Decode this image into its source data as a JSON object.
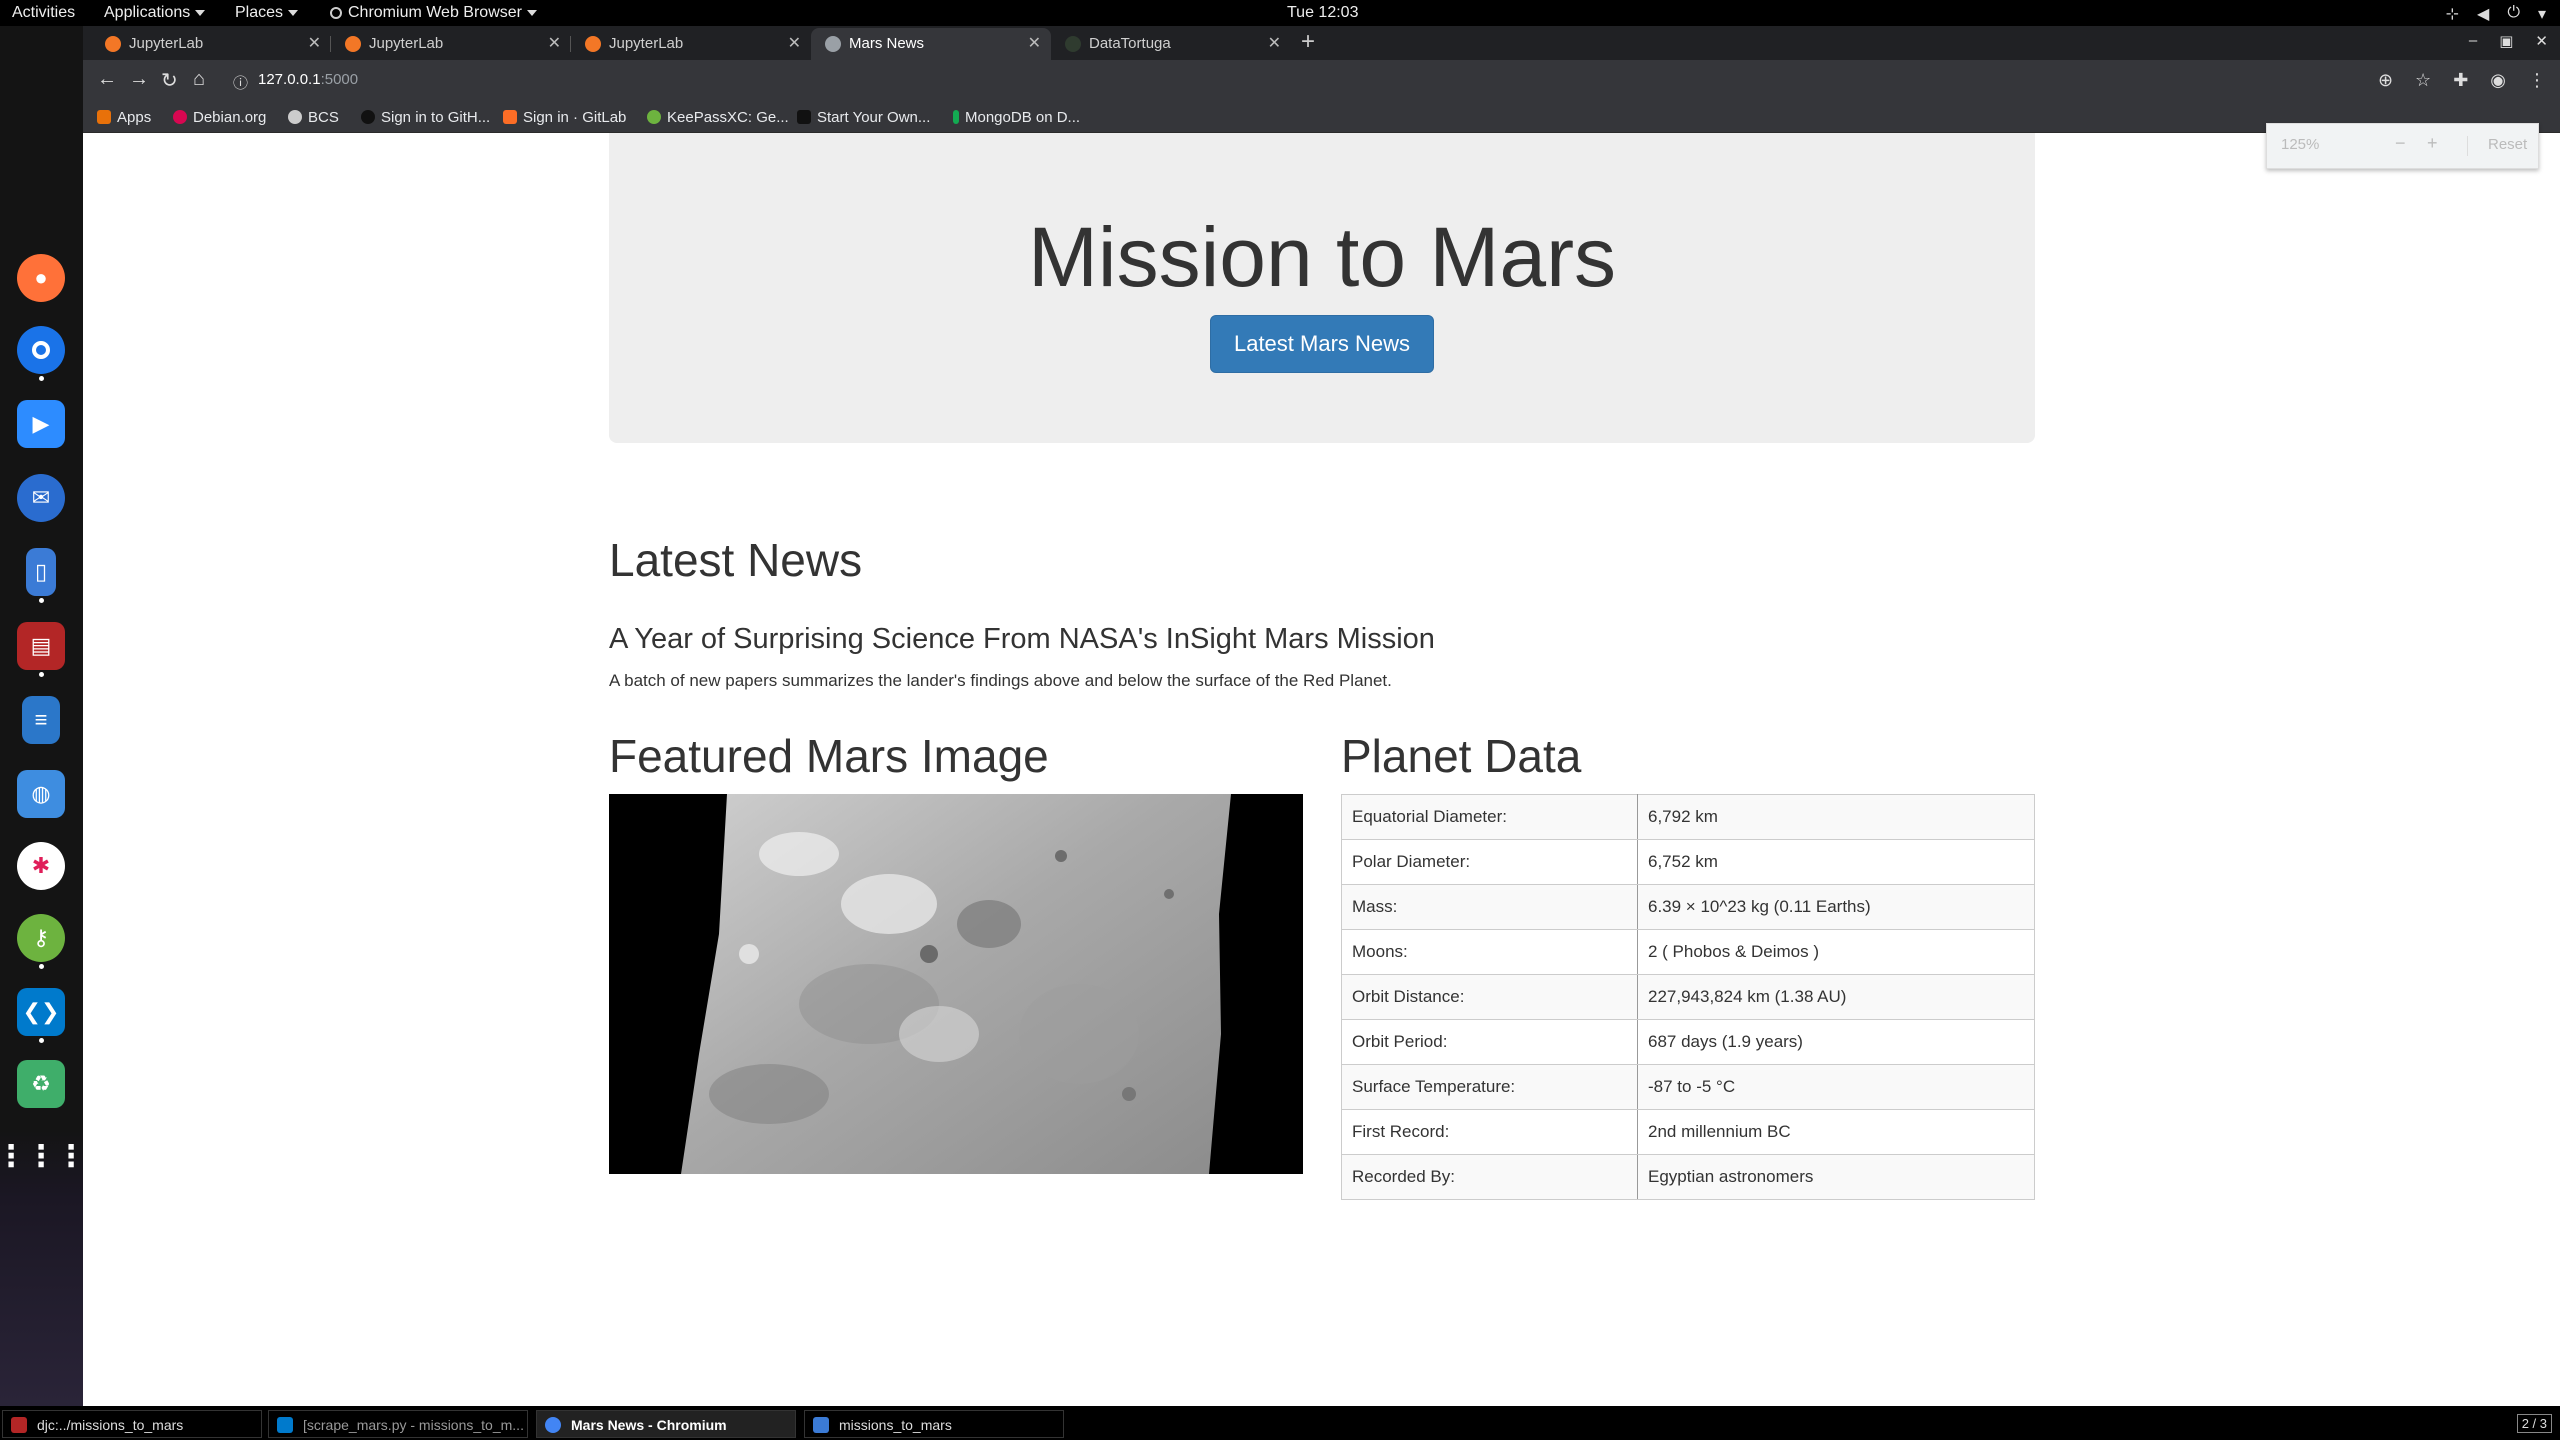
{
  "topbar": {
    "activities": "Activities",
    "applications": "Applications",
    "places": "Places",
    "active_app": "Chromium Web Browser",
    "clock": "Tue 12:03"
  },
  "dock": {
    "apps": [
      {
        "name": "firefox",
        "color": "#ff7139"
      },
      {
        "name": "chromium",
        "color": "#4285f4"
      },
      {
        "name": "zoom",
        "color": "#2d8cff"
      },
      {
        "name": "thunderbird",
        "color": "#2a6ccf"
      },
      {
        "name": "phone-app",
        "color": "#3b7bd6"
      },
      {
        "name": "terminal",
        "color": "#b32626"
      },
      {
        "name": "libreoffice-writer",
        "color": "#2b77c9"
      },
      {
        "name": "software-store",
        "color": "#3e8de0"
      },
      {
        "name": "slack",
        "color": "#e01e5a"
      },
      {
        "name": "keepassxc",
        "color": "#6db33f"
      },
      {
        "name": "vscode",
        "color": "#007acc"
      },
      {
        "name": "trash",
        "color": "#3fae6a"
      },
      {
        "name": "show-apps",
        "color": "#141414"
      }
    ]
  },
  "browser": {
    "tabs": [
      {
        "label": "JupyterLab",
        "active": false
      },
      {
        "label": "JupyterLab",
        "active": false
      },
      {
        "label": "JupyterLab",
        "active": false
      },
      {
        "label": "Mars News",
        "active": true
      },
      {
        "label": "DataTortuga",
        "active": false
      }
    ],
    "url_host": "127.0.0.1",
    "url_port": ":5000",
    "bookmarks": [
      "Apps",
      "Debian.org",
      "BCS",
      "Sign in to GitH...",
      "Sign in · GitLab",
      "KeePassXC: Ge...",
      "Start Your Own...",
      "MongoDB on D..."
    ],
    "zoom": {
      "level": "125%",
      "minus": "−",
      "plus": "+",
      "reset": "Reset"
    }
  },
  "page": {
    "title": "Mission to Mars",
    "news_button": "Latest Mars News",
    "latest_news_heading": "Latest News",
    "news_title": "A Year of Surprising Science From NASA's InSight Mars Mission",
    "news_teaser": "A batch of new papers summarizes the lander's findings above and below the surface of the Red Planet.",
    "featured_heading": "Featured Mars Image",
    "planet_heading": "Planet Data",
    "planet_data": [
      {
        "label": "Equatorial Diameter:",
        "value": "6,792 km"
      },
      {
        "label": "Polar Diameter:",
        "value": "6,752 km"
      },
      {
        "label": "Mass:",
        "value": "6.39 × 10^23 kg (0.11 Earths)"
      },
      {
        "label": "Moons:",
        "value": "2 ( Phobos & Deimos )"
      },
      {
        "label": "Orbit Distance:",
        "value": "227,943,824 km (1.38 AU)"
      },
      {
        "label": "Orbit Period:",
        "value": "687 days (1.9 years)"
      },
      {
        "label": "Surface Temperature:",
        "value": "-87 to -5 °C"
      },
      {
        "label": "First Record:",
        "value": "2nd millennium BC"
      },
      {
        "label": "Recorded By:",
        "value": "Egyptian astronomers"
      }
    ]
  },
  "taskbar": {
    "items": [
      {
        "label": "djc:../missions_to_mars",
        "active": false
      },
      {
        "label": "[scrape_mars.py - missions_to_m...",
        "active": false
      },
      {
        "label": "Mars News - Chromium",
        "active": true
      },
      {
        "label": "missions_to_mars",
        "active": false
      }
    ],
    "workspace": "2 / 3"
  }
}
